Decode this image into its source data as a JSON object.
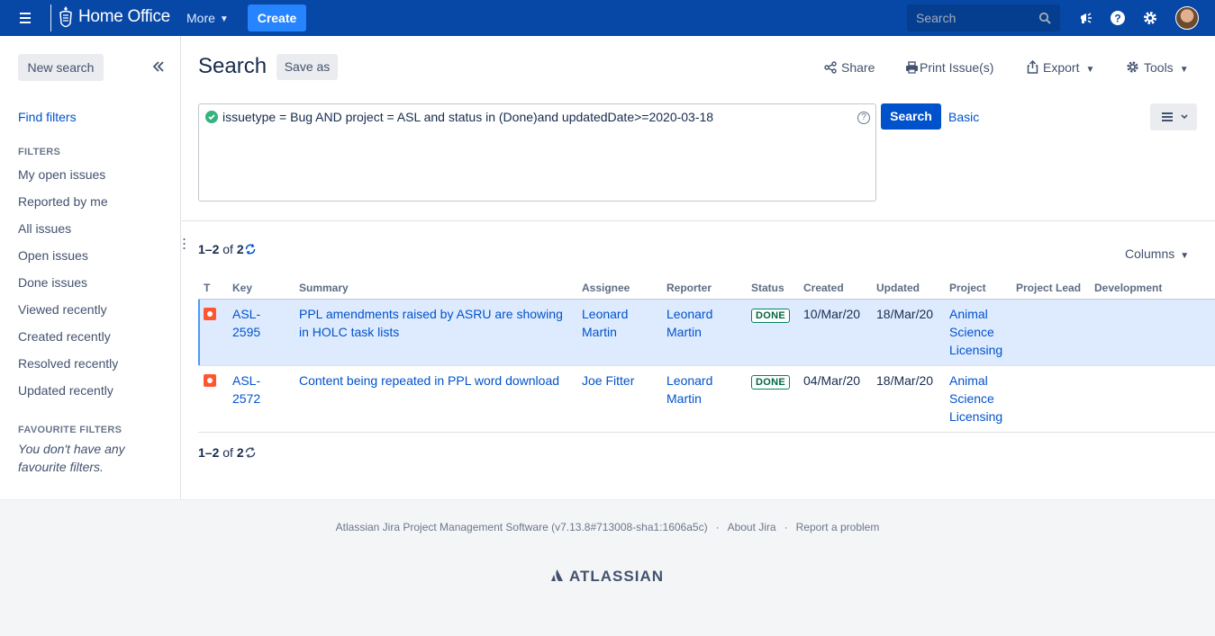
{
  "topbar": {
    "brand": "Home Office",
    "more": "More",
    "create": "Create",
    "search_placeholder": "Search"
  },
  "sidebar": {
    "new_search": "New search",
    "find_filters": "Find filters",
    "filters_heading": "FILTERS",
    "filters": [
      "My open issues",
      "Reported by me",
      "All issues",
      "Open issues",
      "Done issues",
      "Viewed recently",
      "Created recently",
      "Resolved recently",
      "Updated recently"
    ],
    "favourites_heading": "FAVOURITE FILTERS",
    "favourites_empty": "You don't have any favourite filters."
  },
  "main": {
    "title": "Search",
    "save_as": "Save as",
    "share": "Share",
    "print": "Print Issue(s)",
    "export": "Export",
    "tools": "Tools",
    "jql": "issuetype = Bug AND project = ASL and status in (Done)and updatedDate>=2020-03-18",
    "search_button": "Search",
    "basic": "Basic",
    "count_range": "1–2",
    "count_of": "of",
    "count_total": "2",
    "columns": "Columns"
  },
  "table": {
    "headers": [
      "T",
      "Key",
      "Summary",
      "Assignee",
      "Reporter",
      "Status",
      "Created",
      "Updated",
      "Project",
      "Project Lead",
      "Development"
    ],
    "rows": [
      {
        "key": "ASL-2595",
        "summary": "PPL amendments raised by ASRU are showing in HOLC task lists",
        "assignee": "Leonard Martin",
        "reporter": "Leonard Martin",
        "status": "DONE",
        "created": "10/Mar/20",
        "updated": "18/Mar/20",
        "project": "Animal Science Licensing",
        "lead": "",
        "development": ""
      },
      {
        "key": "ASL-2572",
        "summary": "Content being repeated in PPL word download",
        "assignee": "Joe Fitter",
        "reporter": "Leonard Martin",
        "status": "DONE",
        "created": "04/Mar/20",
        "updated": "18/Mar/20",
        "project": "Animal Science Licensing",
        "lead": "",
        "development": ""
      }
    ]
  },
  "footer": {
    "software": "Atlassian Jira Project Management Software (v7.13.8#713008-sha1:1606a5c)",
    "about": "About Jira",
    "report": "Report a problem",
    "logo": "ATLASSIAN"
  },
  "colors": {
    "nav": "#0747a6",
    "create": "#2684ff",
    "primary": "#0052cc",
    "bug": "#ff5630",
    "done": "#00875a",
    "selected_row": "#deebff"
  }
}
